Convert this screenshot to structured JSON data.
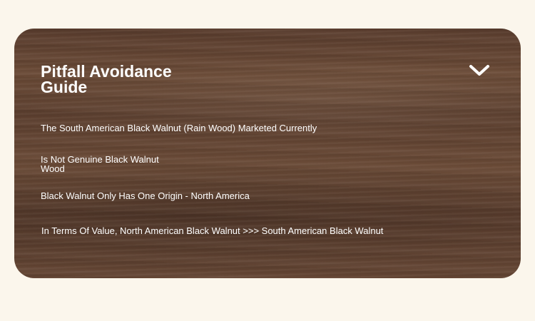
{
  "guide": {
    "title": "Pitfall Avoidance Guide",
    "toggle_icon": "chevron-down-icon",
    "lines": [
      "The South American Black Walnut (Rain Wood) Marketed Currently",
      "Is Not Genuine Black Walnut Wood",
      "Black Walnut Only Has One Origin - North America",
      "In Terms Of Value, North American Black Walnut >>> South American Black Walnut"
    ]
  },
  "colors": {
    "page_background": "#fbf6ec",
    "card_wood": "#5f4231",
    "text": "#ffffff"
  }
}
